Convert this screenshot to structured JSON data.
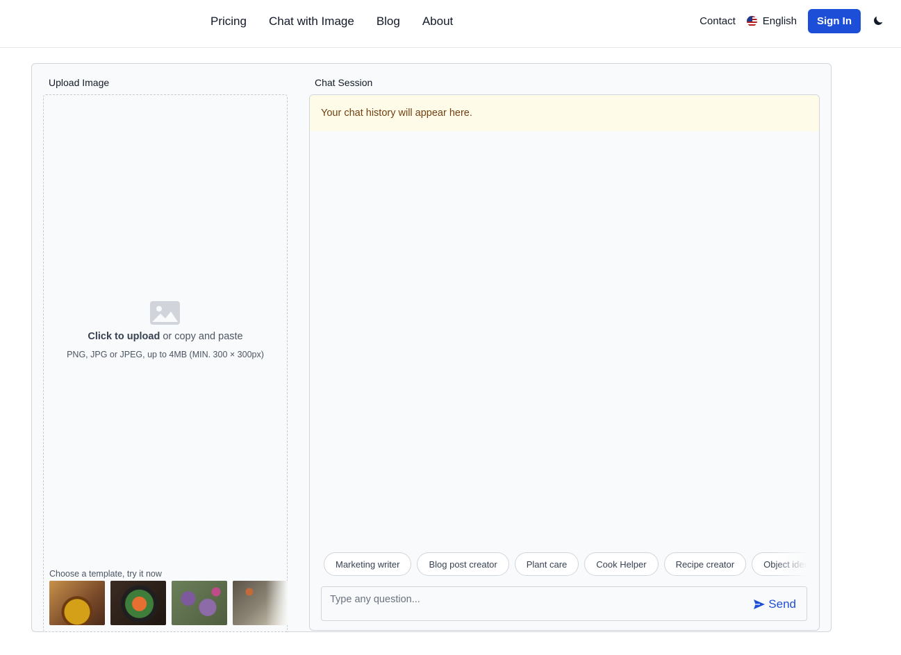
{
  "header": {
    "nav": [
      "Pricing",
      "Chat with Image",
      "Blog",
      "About"
    ],
    "contact": "Contact",
    "language": "English",
    "sign_in": "Sign In"
  },
  "upload": {
    "title": "Upload Image",
    "click_text": "Click to upload",
    "or_text": " or copy and paste",
    "hint": "PNG, JPG or JPEG, up to 4MB (MIN. 300 × 300px)",
    "template_label": "Choose a template, try it now"
  },
  "chat": {
    "title": "Chat Session",
    "history_placeholder": "Your chat history will appear here.",
    "chips": [
      "Marketing writer",
      "Blog post creator",
      "Plant care",
      "Cook Helper",
      "Recipe creator",
      "Object identifier"
    ],
    "input_placeholder": "Type any question...",
    "send_label": "Send"
  }
}
